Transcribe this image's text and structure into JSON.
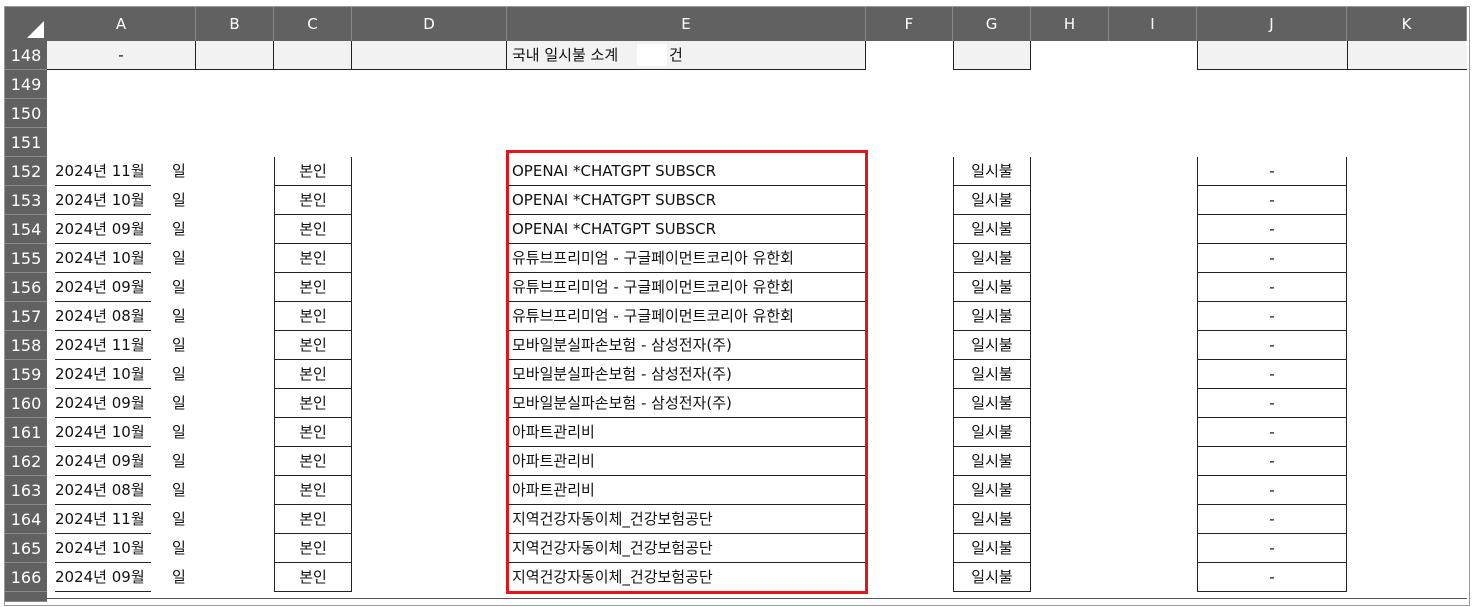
{
  "sheet": {
    "columns": [
      "A",
      "B",
      "C",
      "D",
      "E",
      "F",
      "G",
      "H",
      "I",
      "J",
      "K"
    ],
    "summary_row": {
      "row": "148",
      "a": "-",
      "e_label": "국내 일시불 소계",
      "e_unit": "건"
    },
    "empty_rows": [
      "149",
      "150",
      "151"
    ],
    "rows": [
      {
        "row": "152",
        "date": "2024년 11월",
        "day": "일",
        "c": "본인",
        "e": "OPENAI *CHATGPT SUBSCR",
        "g": "일시불",
        "j": "-"
      },
      {
        "row": "153",
        "date": "2024년 10월",
        "day": "일",
        "c": "본인",
        "e": "OPENAI *CHATGPT SUBSCR",
        "g": "일시불",
        "j": "-"
      },
      {
        "row": "154",
        "date": "2024년 09월",
        "day": "일",
        "c": "본인",
        "e": "OPENAI *CHATGPT SUBSCR",
        "g": "일시불",
        "j": "-"
      },
      {
        "row": "155",
        "date": "2024년 10월",
        "day": "일",
        "c": "본인",
        "e": "유튜브프리미엄 - 구글페이먼트코리아 유한회",
        "g": "일시불",
        "j": "-"
      },
      {
        "row": "156",
        "date": "2024년 09월",
        "day": "일",
        "c": "본인",
        "e": "유튜브프리미엄 - 구글페이먼트코리아 유한회",
        "g": "일시불",
        "j": "-"
      },
      {
        "row": "157",
        "date": "2024년 08월",
        "day": "일",
        "c": "본인",
        "e": "유튜브프리미엄 - 구글페이먼트코리아 유한회",
        "g": "일시불",
        "j": "-"
      },
      {
        "row": "158",
        "date": "2024년 11월",
        "day": "일",
        "c": "본인",
        "e": "모바일분실파손보험 - 삼성전자(주)",
        "g": "일시불",
        "j": "-"
      },
      {
        "row": "159",
        "date": "2024년 10월",
        "day": "일",
        "c": "본인",
        "e": "모바일분실파손보험 - 삼성전자(주)",
        "g": "일시불",
        "j": "-"
      },
      {
        "row": "160",
        "date": "2024년 09월",
        "day": "일",
        "c": "본인",
        "e": "모바일분실파손보험 - 삼성전자(주)",
        "g": "일시불",
        "j": "-"
      },
      {
        "row": "161",
        "date": "2024년 10월",
        "day": "일",
        "c": "본인",
        "e": "아파트관리비",
        "g": "일시불",
        "j": "-"
      },
      {
        "row": "162",
        "date": "2024년 09월",
        "day": "일",
        "c": "본인",
        "e": "아파트관리비",
        "g": "일시불",
        "j": "-"
      },
      {
        "row": "163",
        "date": "2024년 08월",
        "day": "일",
        "c": "본인",
        "e": "아파트관리비",
        "g": "일시불",
        "j": "-"
      },
      {
        "row": "164",
        "date": "2024년 11월",
        "day": "일",
        "c": "본인",
        "e": "지역건강자동이체_건강보험공단",
        "g": "일시불",
        "j": "-"
      },
      {
        "row": "165",
        "date": "2024년 10월",
        "day": "일",
        "c": "본인",
        "e": "지역건강자동이체_건강보험공단",
        "g": "일시불",
        "j": "-"
      },
      {
        "row": "166",
        "date": "2024년 09월",
        "day": "일",
        "c": "본인",
        "e": "지역건강자동이체_건강보험공단",
        "g": "일시불",
        "j": "-"
      }
    ]
  },
  "colors": {
    "header_bg": "#616161",
    "header_text": "#ffffff",
    "highlight": "#e3141c",
    "summary_fill": "#f2f2f2"
  }
}
